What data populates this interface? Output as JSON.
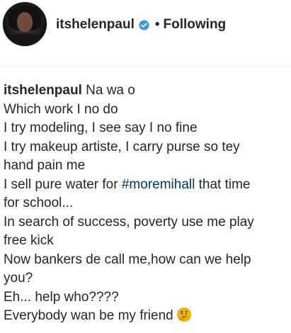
{
  "header": {
    "username": "itshelenpaul",
    "separator": "•",
    "follow_status": "Following",
    "verified_icon": "verified-badge-icon"
  },
  "caption": {
    "username": "itshelenpaul",
    "lines": [
      "Na wa o",
      "Which work I no do",
      "I try modeling, I see say I no fine",
      "I try makeup artiste, I carry purse so tey",
      "hand pain me",
      "I sell pure water for",
      "#moremihall",
      "that time",
      "for school...",
      "In search of success, poverty use me play",
      "free kick",
      "Now bankers de call me,how can we help",
      "you?",
      "Eh... help who????",
      "Everybody wan be my friend"
    ],
    "end_emoji": "thinking-face-emoji"
  },
  "colors": {
    "text": "#262626",
    "hashtag": "#00376b",
    "verified": "#3897f0",
    "divider": "#efefef"
  }
}
